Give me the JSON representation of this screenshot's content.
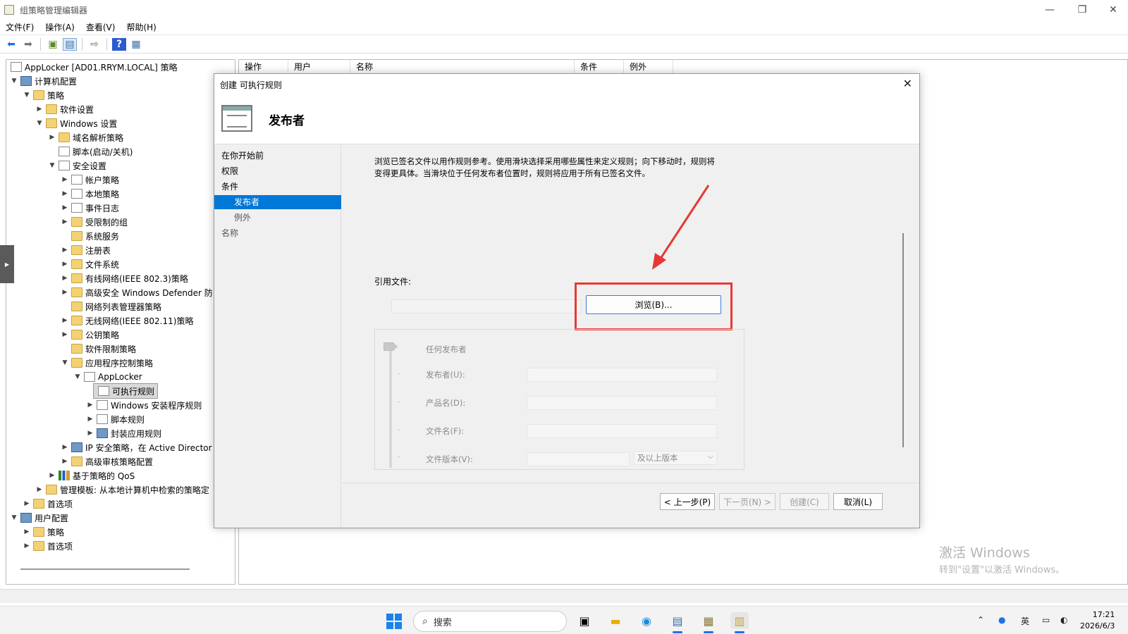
{
  "window": {
    "title": "组策略管理编辑器",
    "controls": {
      "minimize": "—",
      "restore": "❐",
      "close": "✕"
    }
  },
  "menu": [
    "文件(F)",
    "操作(A)",
    "查看(V)",
    "帮助(H)"
  ],
  "tree": {
    "root": "AppLocker [AD01.RRYM.LOCAL] 策略",
    "computer_config": "计算机配置",
    "policies": "策略",
    "software_settings": "软件设置",
    "windows_settings": "Windows 设置",
    "dns_policy": "域名解析策略",
    "scripts": "脚本(启动/关机)",
    "security_settings": "安全设置",
    "account_policies": "帐户策略",
    "local_policies": "本地策略",
    "event_log": "事件日志",
    "restricted_groups": "受限制的组",
    "system_services": "系统服务",
    "registry": "注册表",
    "file_system": "文件系统",
    "wired_network": "有线网络(IEEE 802.3)策略",
    "defender_firewall": "高级安全 Windows Defender 防",
    "network_list": "网络列表管理器策略",
    "wireless_network": "无线网络(IEEE 802.11)策略",
    "public_key": "公钥策略",
    "software_restriction": "软件限制策略",
    "app_control": "应用程序控制策略",
    "applocker": "AppLocker",
    "executable_rules": "可执行规则",
    "installer_rules": "Windows 安装程序规则",
    "script_rules": "脚本规则",
    "packaged_rules": "封装应用规则",
    "ip_security": "IP 安全策略，在 Active Director",
    "advanced_audit": "高级审核策略配置",
    "qos": "基于策略的 QoS",
    "admin_templates": "管理模板: 从本地计算机中检索的策略定",
    "preferences": "首选项",
    "user_config": "用户配置",
    "user_policies": "策略",
    "user_preferences": "首选项"
  },
  "list_columns": [
    "操作",
    "用户",
    "名称",
    "条件",
    "例外"
  ],
  "dialog": {
    "title": "创建 可执行规则",
    "close": "✕",
    "heading": "发布者",
    "nav": {
      "before_begin": "在你开始前",
      "permissions": "权限",
      "conditions": "条件",
      "publisher": "发布者",
      "exceptions": "例外",
      "name": "名称"
    },
    "description_line1": "浏览已签名文件以用作规则参考。使用滑块选择采用哪些属性来定义规则；向下移动时，规则将",
    "description_line2": "变得更具体。当滑块位于任何发布者位置时，规则将应用于所有已签名文件。",
    "reference_file_label": "引用文件:",
    "browse_button": "浏览(B)...",
    "any_publisher": "任何发布者",
    "publisher_label": "发布者(U):",
    "product_label": "产品名(D):",
    "filename_label": "文件名(F):",
    "version_label": "文件版本(V):",
    "version_option": "及以上版本",
    "buttons": {
      "back": "< 上一步(P)",
      "next": "下一页(N) >",
      "create": "创建(C)",
      "cancel": "取消(L)"
    }
  },
  "watermark": {
    "line1": "激活 Windows",
    "line2": "转到\"设置\"以激活 Windows。"
  },
  "taskbar": {
    "search_placeholder": "搜索",
    "ime": "英",
    "time": "17:21",
    "date": "2026/6/3"
  },
  "colors": {
    "accent": "#0078d7",
    "highlight_red": "#e53935"
  }
}
